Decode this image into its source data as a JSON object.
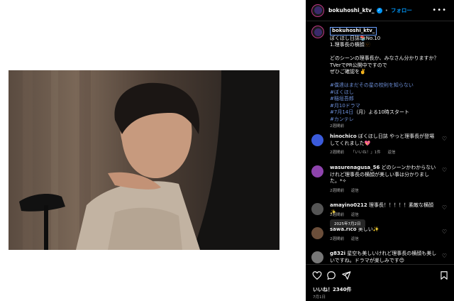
{
  "post": {
    "username": "bokuhoshi_ktv_",
    "follow_label": "フォロー",
    "dot": "•",
    "more": "•••",
    "caption": {
      "username": "bokuhoshi_ktv_",
      "line1": "ぼくほし日誌📚No.10",
      "line2": "1.理事長の横顔🫥",
      "line3": "どのシーンの理事長か、みなさん分かりますか？",
      "line4": "TVerでPR公開中ですので",
      "line5": "ぜひご確認を✌️",
      "hashtags": [
        "#僕達はまだその星の校則を知らない",
        "#ぼくほし",
        "#稲垣吾郎",
        "#月10ドラマ"
      ],
      "hashtag5": "#7月14日",
      "line_tail": "（月）よる10時スタート",
      "hashtag6": "#カンテレ",
      "time": "2週間前"
    },
    "likes": "いいね！2340件",
    "date": "7月1日"
  },
  "comments": [
    {
      "user": "hinochico",
      "text": "ぼくほし日誌 やっと理事長が登場してくれました💖",
      "time": "2週間前",
      "likes": "「いいね！」1件",
      "reply": "返信",
      "avatar_color": "#3b5bdb"
    },
    {
      "user": "wasurenagusa_56",
      "text": "どのシーンかわからないけれど理事長の横顔が美しい事は分かりました。*✧",
      "time": "2週間前",
      "reply": "返信",
      "avatar_color": "#8e44ad"
    },
    {
      "user": "amayino0212",
      "text": "理事長！！！！！素敵な横顔✨",
      "time": "2週間前",
      "reply": "返信",
      "avatar_color": "#555555"
    },
    {
      "user": "sawa.rico",
      "text": "美しい✨",
      "time": "2週間前",
      "reply": "返信",
      "avatar_color": "#6b4e3a"
    },
    {
      "user": "g832i",
      "text": "星空も美しいけれど理事長の横顔も美しいですね。ドラマが楽しみです😊",
      "time": "2週間前",
      "reply": "返信",
      "avatar_color": "#777777"
    }
  ],
  "date_tooltip": "2025年7月2日",
  "icons": {
    "like": "heart-icon",
    "comment": "comment-icon",
    "share": "share-icon",
    "save": "bookmark-icon"
  }
}
